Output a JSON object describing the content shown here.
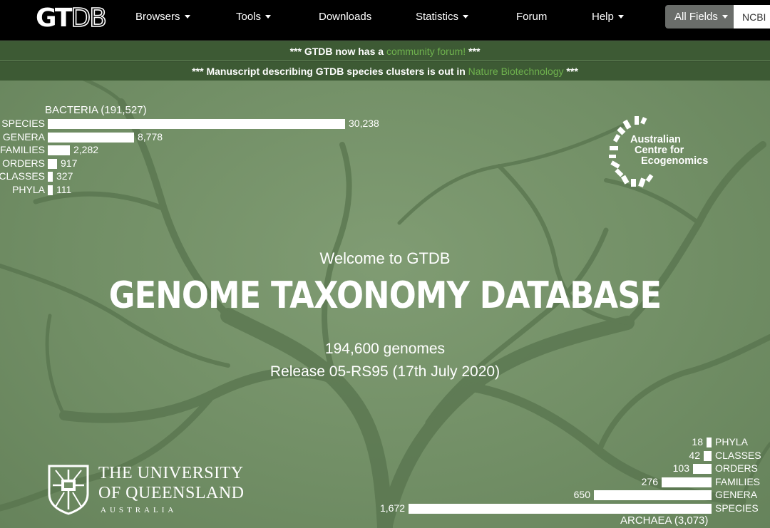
{
  "navbar": {
    "logo_part1": "GT",
    "logo_part2": "DB",
    "items": [
      "Browsers",
      "Tools",
      "Downloads",
      "Statistics",
      "Forum",
      "Help"
    ],
    "search_select": "All Fields",
    "search_value": "NCBI"
  },
  "announcements": {
    "a1_prefix": "*** GTDB now has a ",
    "a1_link": "community forum!",
    "a1_suffix": " ***",
    "a2_prefix": "*** Manuscript describing GTDB species clusters is out in ",
    "a2_link": "Nature Biotechnology",
    "a2_suffix": " ***"
  },
  "hero": {
    "welcome": "Welcome to GTDB",
    "title": "GENOME TAXONOMY DATABASE",
    "genomes": "194,600 genomes",
    "release": "Release 05-RS95 (17th July 2020)"
  },
  "bacteria": {
    "label": "BACTERIA (191,527)",
    "rows": [
      {
        "name": "SPECIES",
        "value": 30238,
        "display": "30,238"
      },
      {
        "name": "GENERA",
        "value": 8778,
        "display": "8,778"
      },
      {
        "name": "FAMILIES",
        "value": 2282,
        "display": "2,282"
      },
      {
        "name": "ORDERS",
        "value": 917,
        "display": "917"
      },
      {
        "name": "CLASSES",
        "value": 327,
        "display": "327"
      },
      {
        "name": "PHYLA",
        "value": 111,
        "display": "111"
      }
    ]
  },
  "archaea": {
    "label": "ARCHAEA (3,073)",
    "rows": [
      {
        "name": "PHYLA",
        "value": 18,
        "display": "18"
      },
      {
        "name": "CLASSES",
        "value": 42,
        "display": "42"
      },
      {
        "name": "ORDERS",
        "value": 103,
        "display": "103"
      },
      {
        "name": "FAMILIES",
        "value": 276,
        "display": "276"
      },
      {
        "name": "GENERA",
        "value": 650,
        "display": "650"
      },
      {
        "name": "SPECIES",
        "value": 1672,
        "display": "1,672"
      }
    ]
  },
  "ace_logo": {
    "line1": "Australian",
    "line2": "Centre for",
    "line3": "Ecogenomics"
  },
  "uq_logo": {
    "line1": "THE UNIVERSITY",
    "line2": "OF QUEENSLAND",
    "line3": "AUSTRALIA"
  },
  "colors": {
    "navbar_bg": "#000000",
    "announce_bg": "#3d5a34",
    "link_green": "#6fb24e",
    "hero_green": "#728f66"
  }
}
